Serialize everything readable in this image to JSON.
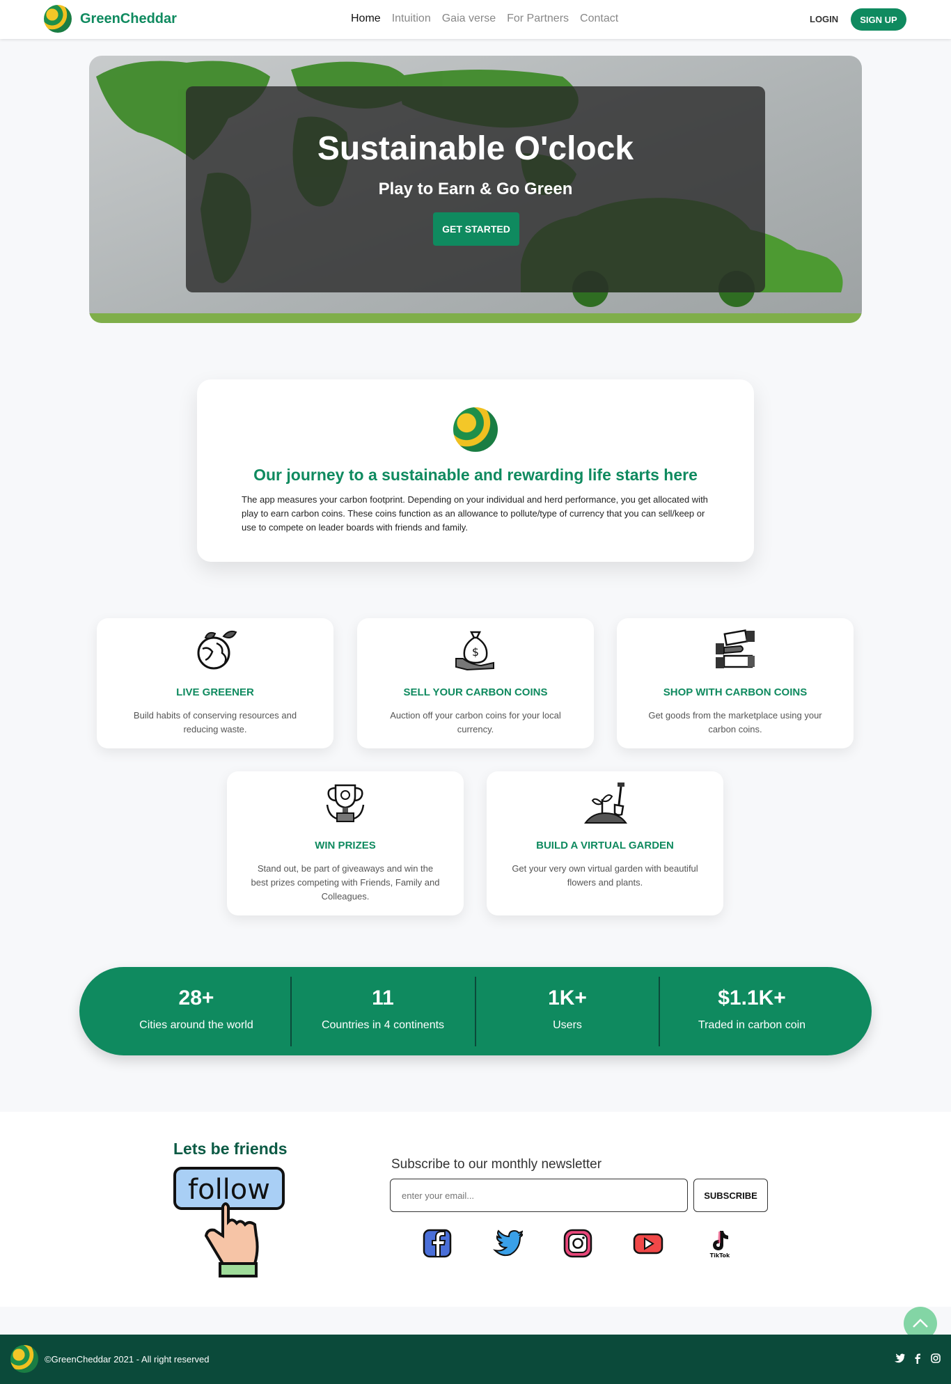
{
  "nav": {
    "brand": "GreenCheddar",
    "links": [
      "Home",
      "Intuition",
      "Gaia verse",
      "For Partners",
      "Contact"
    ],
    "active_link": "Home",
    "login": "LOGIN",
    "signup": "SIGN UP"
  },
  "hero": {
    "title": "Sustainable O'clock",
    "subtitle": "Play to Earn & Go Green",
    "cta": "GET STARTED"
  },
  "journey": {
    "title": "Our journey to a sustainable and rewarding life starts here",
    "text": "The app measures your carbon footprint. Depending on your individual and herd performance, you get allocated with play to earn carbon coins. These coins function as an allowance to pollute/type of currency that you can sell/keep or use to compete on leader boards with friends and family."
  },
  "features": [
    {
      "icon": "earth-leaves-icon",
      "title": "LIVE GREENER",
      "text": "Build habits of conserving resources and reducing waste."
    },
    {
      "icon": "money-bag-hand-icon",
      "title": "SELL YOUR CARBON COINS",
      "text": "Auction off your carbon coins for your local currency."
    },
    {
      "icon": "cash-exchange-icon",
      "title": "SHOP WITH CARBON COINS",
      "text": "Get goods from the marketplace using your carbon coins."
    },
    {
      "icon": "trophy-icon",
      "title": "WIN PRIZES",
      "text": "Stand out, be part of giveaways and win the best prizes competing with Friends, Family and Colleagues."
    },
    {
      "icon": "plant-shovel-icon",
      "title": "BUILD A VIRTUAL GARDEN",
      "text": "Get your very own virtual garden with beautiful flowers and plants."
    }
  ],
  "stats": [
    {
      "value": "28+",
      "label": "Cities around the world"
    },
    {
      "value": "11",
      "label": "Countries in 4 continents"
    },
    {
      "value": "1K+",
      "label": "Users"
    },
    {
      "value": "$1.1K+",
      "label": "Traded in carbon coin"
    }
  ],
  "social": {
    "friends_title": "Lets be friends",
    "follow_text": "follow",
    "newsletter_title": "Subscribe to our monthly newsletter",
    "email_placeholder": "enter your email...",
    "subscribe": "SUBSCRIBE",
    "icons": [
      "facebook-icon",
      "twitter-icon",
      "instagram-icon",
      "youtube-icon",
      "tiktok-icon"
    ],
    "tiktok_label": "TikTok"
  },
  "footer": {
    "copyright": "©GreenCheddar 2021 - All right reserved",
    "icons": [
      "twitter-icon",
      "facebook-icon",
      "instagram-icon"
    ]
  },
  "colors": {
    "brand_green": "#0f8a5f",
    "footer_green": "#0b4a3a",
    "page_bg": "#f7f8fa"
  }
}
